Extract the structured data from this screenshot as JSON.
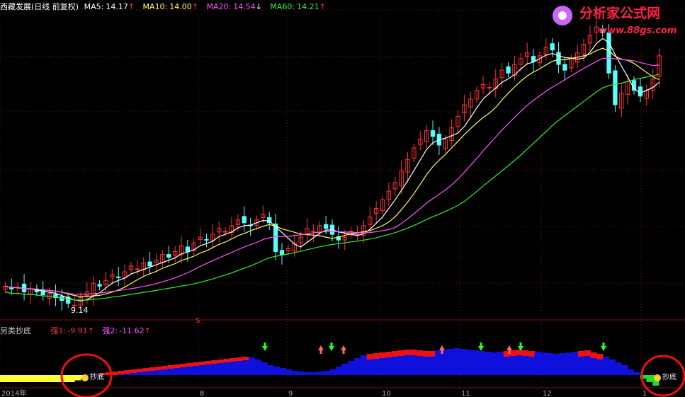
{
  "header": {
    "stock_title": "西藏发展(日线 前复权)",
    "ma5": {
      "label": "MA5:",
      "value": "14.17",
      "arrow": "↑",
      "color": "#ffffff"
    },
    "ma10": {
      "label": "MA10:",
      "value": "14.00",
      "arrow": "↑",
      "color": "#ffff55"
    },
    "ma20": {
      "label": "MA20:",
      "value": "14.54",
      "arrow": "↓",
      "color": "#ff55ff"
    },
    "ma60": {
      "label": "MA60:",
      "value": "14.21",
      "arrow": "↑",
      "color": "#33ee33"
    }
  },
  "logo": {
    "name": "分析家公式网",
    "url_text": "www.88gs.com"
  },
  "annotations": {
    "low_price": "9.14",
    "marker_s": "S"
  },
  "indicator": {
    "name": "另类抄底",
    "qiang1": {
      "label": "强1:",
      "value": "-9.91",
      "arrow": "↑"
    },
    "qiang2": {
      "label": "强2:",
      "value": "-11.62",
      "arrow": "↑"
    },
    "signal_left": "抄底",
    "signal_right": "抄底"
  },
  "x_axis": {
    "labels": [
      "2014年",
      "8",
      "9",
      "10",
      "11",
      "12",
      "1"
    ]
  },
  "colors": {
    "up": "#ff3333",
    "down": "#55ffff",
    "ma5": "#ffffff",
    "ma10": "#ffff55",
    "ma20": "#ff55ff",
    "ma60": "#33ee33",
    "grid": "#7a1010",
    "bar_blue": "#1010dd",
    "bar_red": "#ee1111",
    "bar_yellow": "#ffff33",
    "bar_green": "#22dd22",
    "circle": "#ee1111"
  },
  "chart_data": {
    "type": "candlestick",
    "series": [
      {
        "name": "MA5"
      },
      {
        "name": "MA10"
      },
      {
        "name": "MA20"
      },
      {
        "name": "MA60"
      }
    ],
    "closes": [
      9.8,
      9.7,
      9.75,
      9.6,
      9.7,
      9.6,
      9.5,
      9.55,
      9.4,
      9.3,
      9.2,
      9.14,
      9.4,
      9.6,
      9.9,
      9.8,
      10.0,
      10.2,
      10.1,
      10.3,
      10.5,
      10.4,
      10.6,
      10.5,
      10.7,
      10.9,
      10.8,
      11.0,
      11.2,
      11.0,
      11.3,
      11.5,
      11.4,
      11.6,
      11.8,
      11.7,
      11.9,
      12.1,
      12.0,
      11.9,
      12.1,
      12.3,
      12.0,
      11.0,
      10.9,
      11.1,
      11.3,
      11.5,
      11.8,
      11.7,
      11.9,
      11.8,
      11.6,
      11.4,
      11.5,
      11.7,
      11.6,
      11.9,
      12.2,
      12.5,
      12.8,
      13.1,
      13.4,
      13.8,
      14.2,
      14.6,
      14.9,
      15.2,
      15.0,
      14.7,
      14.9,
      15.3,
      15.7,
      16.1,
      16.3,
      16.6,
      16.8,
      16.7,
      17.0,
      17.3,
      17.2,
      17.5,
      17.7,
      17.9,
      17.6,
      17.8,
      18.1,
      18.0,
      17.5,
      17.3,
      17.7,
      17.9,
      18.2,
      18.5,
      18.8,
      18.6,
      17.2,
      16.1,
      16.5,
      16.9,
      16.6,
      16.4,
      16.6,
      17.0,
      17.8
    ],
    "ylim": [
      8.8,
      19.0
    ],
    "indicator_bars": [
      -2,
      -2,
      -2,
      -2,
      -2,
      -2,
      -2,
      -2,
      -2,
      -2,
      -2,
      -2,
      -1.5,
      -1,
      0.5,
      1,
      1.5,
      2,
      2.5,
      3,
      3.5,
      4,
      4.5,
      5,
      5.5,
      6,
      6.5,
      7,
      7.5,
      8,
      8.5,
      9,
      9.5,
      10,
      10.5,
      11,
      11.5,
      12,
      12.5,
      13,
      12.5,
      11,
      9,
      7,
      6,
      5,
      4,
      3,
      2.5,
      2,
      2,
      2.5,
      3,
      4,
      6,
      8,
      10,
      12,
      14,
      15,
      15.5,
      16,
      16.5,
      17,
      17.5,
      18,
      18,
      17.5,
      17,
      17,
      17.5,
      18,
      18.5,
      19,
      18.5,
      18,
      17.5,
      17,
      16.5,
      16,
      16.5,
      17,
      17.5,
      18,
      17.5,
      17,
      16.5,
      16,
      15.5,
      15,
      15.5,
      16,
      16.5,
      17,
      17.5,
      16,
      15,
      13,
      11,
      9,
      7,
      4,
      2,
      -1,
      -2,
      -3
    ]
  }
}
